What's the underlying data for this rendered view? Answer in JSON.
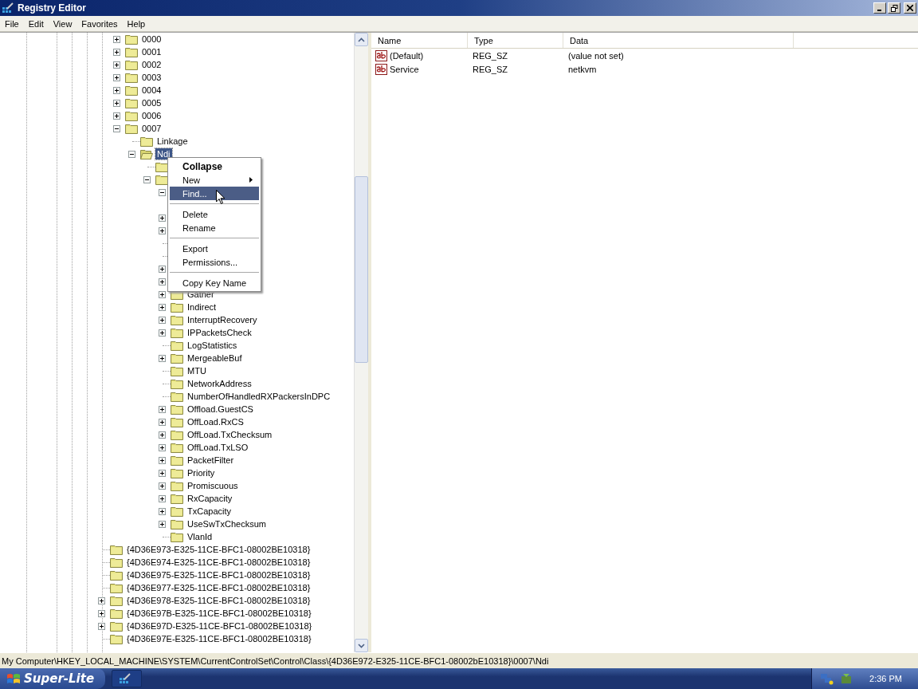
{
  "window": {
    "title": "Registry Editor"
  },
  "menu_bar": [
    "File",
    "Edit",
    "View",
    "Favorites",
    "Help"
  ],
  "tree": {
    "upper_items": [
      {
        "name": "0000",
        "expanded": false,
        "selected": false
      },
      {
        "name": "0001",
        "expanded": false,
        "selected": false
      },
      {
        "name": "0002",
        "expanded": false,
        "selected": false
      },
      {
        "name": "0003",
        "expanded": false,
        "selected": false
      },
      {
        "name": "0004",
        "expanded": false,
        "selected": false
      },
      {
        "name": "0005",
        "expanded": false,
        "selected": false
      },
      {
        "name": "0006",
        "expanded": false,
        "selected": false
      },
      {
        "name": "0007",
        "expanded": true,
        "selected": false,
        "children": [
          {
            "name": "Linkage",
            "selected": false
          },
          {
            "name": "Ndi",
            "expanded": true,
            "selected": true,
            "children": [
              {
                "kind": "leaf"
              },
              {
                "expanded": true,
                "children": [
                  {
                    "expanded": true
                  },
                  {
                    "expanded": false
                  },
                  {
                    "expanded": false
                  },
                  {
                    "kind": "leaf"
                  },
                  {
                    "kind": "leaf"
                  },
                  {
                    "expanded": false
                  },
                  {
                    "expanded": false
                  },
                  {
                    "name": "Gather",
                    "expanded": false,
                    "selected": false
                  },
                  {
                    "name": "Indirect",
                    "expanded": false,
                    "selected": false
                  },
                  {
                    "name": "InterruptRecovery",
                    "expanded": false,
                    "selected": false
                  },
                  {
                    "name": "IPPacketsCheck",
                    "expanded": false,
                    "selected": false
                  },
                  {
                    "name": "LogStatistics",
                    "selected": false
                  },
                  {
                    "name": "MergeableBuf",
                    "expanded": false,
                    "selected": false
                  },
                  {
                    "name": "MTU",
                    "selected": false
                  },
                  {
                    "name": "NetworkAddress",
                    "selected": false
                  },
                  {
                    "name": "NumberOfHandledRXPackersInDPC",
                    "selected": false
                  },
                  {
                    "name": "Offload.GuestCS",
                    "expanded": false,
                    "selected": false
                  },
                  {
                    "name": "OffLoad.RxCS",
                    "expanded": false,
                    "selected": false
                  },
                  {
                    "name": "OffLoad.TxChecksum",
                    "expanded": false,
                    "selected": false
                  },
                  {
                    "name": "OffLoad.TxLSO",
                    "expanded": false,
                    "selected": false
                  },
                  {
                    "name": "PacketFilter",
                    "expanded": false,
                    "selected": false
                  },
                  {
                    "name": "Priority",
                    "expanded": false,
                    "selected": false
                  },
                  {
                    "name": "Promiscuous",
                    "expanded": false,
                    "selected": false
                  },
                  {
                    "name": "RxCapacity",
                    "expanded": false,
                    "selected": false
                  },
                  {
                    "name": "TxCapacity",
                    "expanded": false,
                    "selected": false
                  },
                  {
                    "name": "UseSwTxChecksum",
                    "expanded": false,
                    "selected": false
                  },
                  {
                    "name": "VlanId",
                    "selected": false
                  }
                ]
              }
            ]
          }
        ]
      }
    ],
    "items": [
      {
        "name": "{4D36E973-E325-11CE-BFC1-08002BE10318}",
        "selected": false
      },
      {
        "name": "{4D36E974-E325-11CE-BFC1-08002BE10318}",
        "selected": false
      },
      {
        "name": "{4D36E975-E325-11CE-BFC1-08002BE10318}",
        "selected": false
      },
      {
        "name": "{4D36E977-E325-11CE-BFC1-08002BE10318}",
        "selected": false
      },
      {
        "name": "{4D36E978-E325-11CE-BFC1-08002BE10318}",
        "expanded": false,
        "selected": false
      },
      {
        "name": "{4D36E97B-E325-11CE-BFC1-08002BE10318}",
        "expanded": false,
        "selected": false
      },
      {
        "name": "{4D36E97D-E325-11CE-BFC1-08002BE10318}",
        "expanded": false,
        "selected": false
      },
      {
        "name": "{4D36E97E-E325-11CE-BFC1-08002BE10318}",
        "selected": false
      }
    ]
  },
  "context_menu": [
    {
      "kind": "item",
      "label": "Collapse",
      "default": true,
      "selected": false
    },
    {
      "kind": "item",
      "label": "New",
      "submenu": true,
      "selected": false
    },
    {
      "kind": "item",
      "label": "Find...",
      "selected": true
    },
    {
      "kind": "separator"
    },
    {
      "kind": "item",
      "label": "Delete",
      "selected": false
    },
    {
      "kind": "item",
      "label": "Rename",
      "selected": false
    },
    {
      "kind": "separator"
    },
    {
      "kind": "item",
      "label": "Export",
      "selected": false
    },
    {
      "kind": "item",
      "label": "Permissions...",
      "selected": false
    },
    {
      "kind": "separator"
    },
    {
      "kind": "item",
      "label": "Copy Key Name",
      "selected": false
    }
  ],
  "values": {
    "columns": [
      "Name",
      "Type",
      "Data"
    ],
    "rows": [
      {
        "name": "(Default)",
        "type": "REG_SZ",
        "data": "(value not set)"
      },
      {
        "name": "Service",
        "type": "REG_SZ",
        "data": "netkvm"
      }
    ]
  },
  "status_bar": "My Computer\\HKEY_LOCAL_MACHINE\\SYSTEM\\CurrentControlSet\\Control\\Class\\{4D36E972-E325-11CE-BFC1-08002bE10318}\\0007\\Ndi",
  "taskbar": {
    "start": "Super-Lite",
    "clock": "2:36 PM"
  }
}
